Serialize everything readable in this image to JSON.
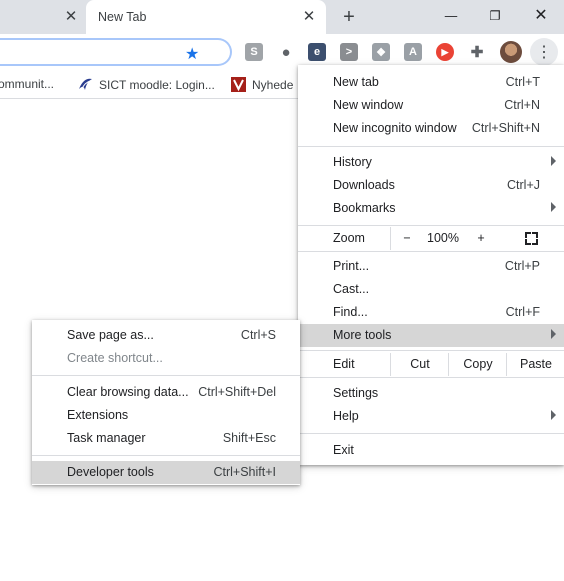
{
  "tabs": {
    "active_title": "New Tab",
    "prev_close_glyph": "✕",
    "close_glyph": "✕",
    "new_tab_glyph": "+"
  },
  "window_controls": {
    "minimize": "—",
    "restore": "❐",
    "close": "✕"
  },
  "toolbar": {
    "star_glyph": "★",
    "extensions": [
      {
        "name": "skype-extension-icon",
        "glyph": "S",
        "color": "#a0a4a8"
      },
      {
        "name": "circle-extension-icon",
        "glyph": "●",
        "color": "#5f6368"
      },
      {
        "name": "e-extension-icon",
        "glyph": "e",
        "color": "#3c4f6e"
      },
      {
        "name": "terminal-extension-icon",
        "glyph": ">",
        "color": "#8a8d91"
      },
      {
        "name": "dropbox-extension-icon",
        "glyph": "❖",
        "color": "#9aa0a6"
      },
      {
        "name": "pdf-extension-icon",
        "glyph": "A",
        "color": "#9aa0a6"
      },
      {
        "name": "media-extension-icon",
        "glyph": "▶",
        "color": "#ea4335"
      },
      {
        "name": "puzzle-extensions-icon",
        "glyph": "✚",
        "color": "#5f6368"
      }
    ],
    "kebab_glyph": "⋮"
  },
  "bookmarks": [
    {
      "label": "ommunit..."
    },
    {
      "label": "SICT moodle: Login..."
    },
    {
      "label": "Nyhede"
    }
  ],
  "main_menu": {
    "new_tab": {
      "label": "New tab",
      "shortcut": "Ctrl+T"
    },
    "new_window": {
      "label": "New window",
      "shortcut": "Ctrl+N"
    },
    "new_incognito": {
      "label": "New incognito window",
      "shortcut": "Ctrl+Shift+N"
    },
    "history": {
      "label": "History"
    },
    "downloads": {
      "label": "Downloads",
      "shortcut": "Ctrl+J"
    },
    "bookmarks": {
      "label": "Bookmarks"
    },
    "zoom": {
      "label": "Zoom",
      "minus": "−",
      "value": "100%",
      "plus": "+"
    },
    "print": {
      "label": "Print...",
      "shortcut": "Ctrl+P"
    },
    "cast": {
      "label": "Cast..."
    },
    "find": {
      "label": "Find...",
      "shortcut": "Ctrl+F"
    },
    "more_tools": {
      "label": "More tools"
    },
    "edit": {
      "label": "Edit",
      "cut": "Cut",
      "copy": "Copy",
      "paste": "Paste"
    },
    "settings": {
      "label": "Settings"
    },
    "help": {
      "label": "Help"
    },
    "exit": {
      "label": "Exit"
    }
  },
  "sub_menu": {
    "save_page": {
      "label": "Save page as...",
      "shortcut": "Ctrl+S"
    },
    "create_shortcut": {
      "label": "Create shortcut..."
    },
    "clear_browsing": {
      "label": "Clear browsing data...",
      "shortcut": "Ctrl+Shift+Del"
    },
    "extensions": {
      "label": "Extensions"
    },
    "task_manager": {
      "label": "Task manager",
      "shortcut": "Shift+Esc"
    },
    "developer_tools": {
      "label": "Developer tools",
      "shortcut": "Ctrl+Shift+I"
    }
  }
}
